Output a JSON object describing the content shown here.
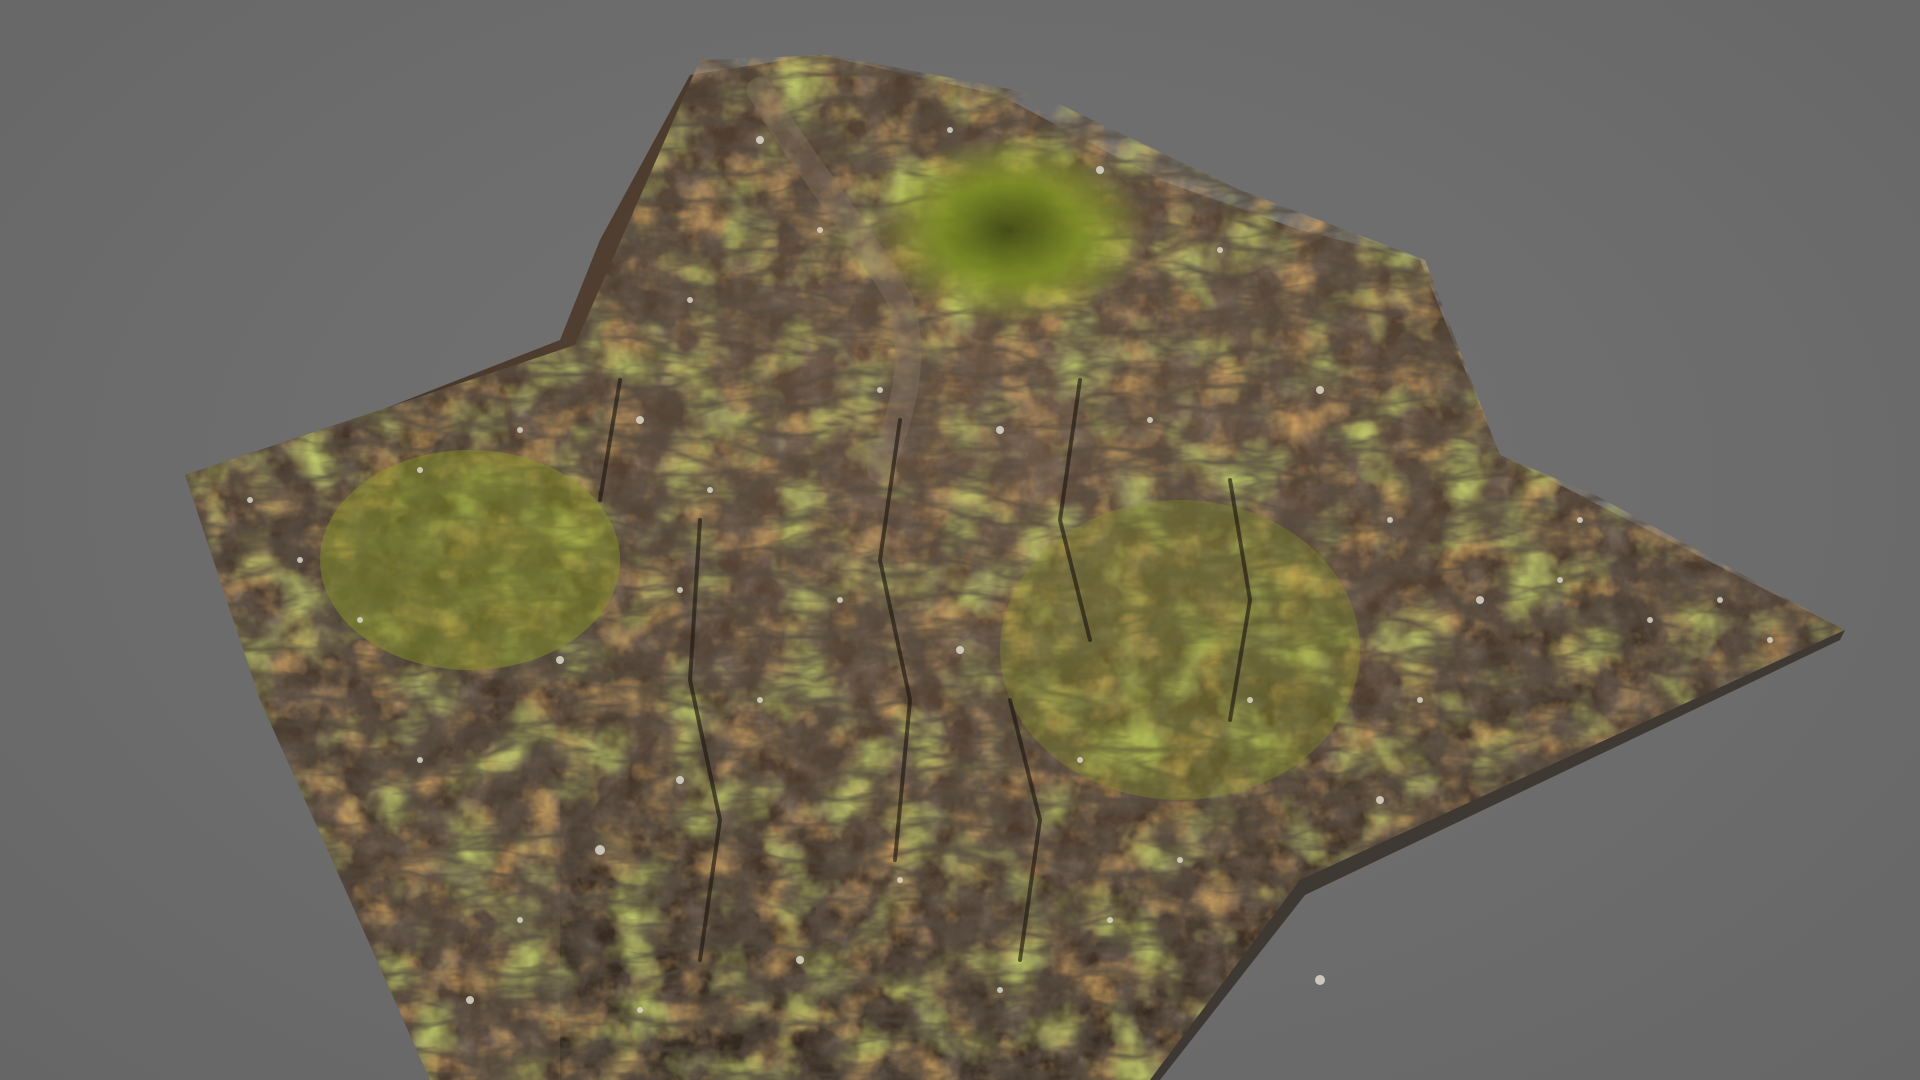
{
  "viewport": {
    "background_color": "#6e6e6e"
  },
  "model": {
    "subject": "mossy-rock-mountain",
    "colors": {
      "rock_dark": "#3a2e25",
      "rock_mid": "#5a4535",
      "rust": "#9a5a22",
      "moss": "#7a8a22",
      "moss_bright": "#a3b02c",
      "lichen": "#d8d4c8"
    }
  }
}
